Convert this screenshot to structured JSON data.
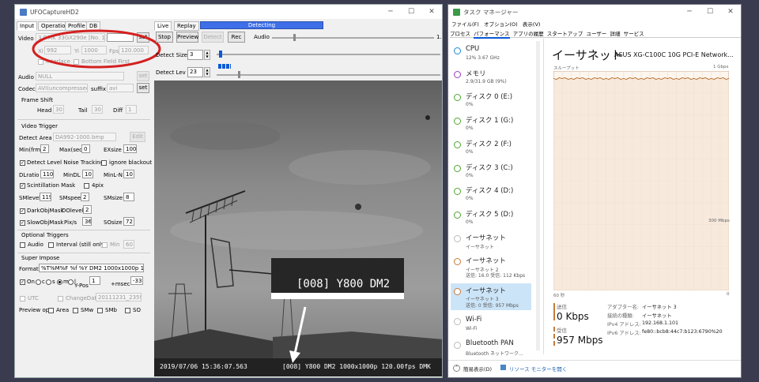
{
  "ufo": {
    "title": "UFOCaptureHD2",
    "tabs": [
      "Input",
      "Operation",
      "Profile",
      "DB"
    ],
    "video_label": "Video",
    "device": "3 DMK 33GX290e [No. 1]",
    "set_label": "set",
    "xi_label": "Xi",
    "xi_value": "992",
    "yi_label": "Yi",
    "yi_value": "1000",
    "fps_label": "Fps",
    "fps_value": "120.000",
    "interlace_label": "Interlace",
    "bottom_field_label": "Bottom Field First",
    "audio_label": "Audio",
    "audio_value": "NULL",
    "codec_label": "Codec",
    "codec_value": "AVI(uncompressed)",
    "suffix_label": "suffix",
    "suffix_value": "avi",
    "frame_shift_title": "Frame Shift",
    "head_label": "Head",
    "head_value": "30",
    "tail_label": "Tail",
    "tail_value": "30",
    "diff_label": "Diff",
    "diff_value": "1",
    "video_trigger_title": "Video Trigger",
    "detect_area_label": "Detect Area",
    "detect_area_value": "DA992-1000.bmp",
    "edit_label": "Edit",
    "minfrm_label": "Min(frm)",
    "minfrm_value": "2",
    "maxsec_label": "Max(sec)",
    "maxsec_value": "0",
    "exsize_label": "EXsize",
    "exsize_value": "100",
    "dlnt_label": "Detect Level Noise Tracking",
    "ignore_blackout_label": "ignore blackout",
    "dlratio_label": "DLratio",
    "dlratio_value": "110",
    "mindl_label": "MinDL",
    "mindl_value": "10",
    "minln_label": "MinL-N",
    "minln_value": "10",
    "scint_label": "Scintillation Mask",
    "pix4_label": "4pix",
    "smlevel_label": "SMlevel",
    "smlevel_value": "119",
    "smspeed_label": "SMspeed",
    "smspeed_value": "2",
    "smsize_label": "SMsize",
    "smsize_value": "8",
    "darkobj_label": "DarkObjMask",
    "dolevel_label": "DOlevel",
    "dolevel_value": "2",
    "slowobj_label": "SlowObjMask",
    "pixs_label": "Pix/s",
    "pixs_value": "36",
    "sosize_label": "SOsize",
    "sosize_value": "72",
    "opt_triggers_title": "Optional Triggers",
    "opt_audio_label": "Audio",
    "interval_label": "Interval (still only",
    "min_label": "Min",
    "min_value": "60",
    "super_impose_title": "Super Impose",
    "format_label": "Format",
    "format_value": "%T%M%F %f %Y DM2 1000x1000p 120.00f",
    "on_label": "On",
    "c_label": "c",
    "s_label": "s",
    "m_label": "m",
    "l_label": "l",
    "ypos_label": "Y-Pos",
    "ypos_value": "1",
    "msec_label": "+msec",
    "msec_value": "-33",
    "utc_label": "UTC",
    "change_date_label": "ChangeDate",
    "change_date_value": "20111231_235959",
    "preview_opt_label": "Preview opt",
    "area_label": "Area",
    "smw_label": "SMw",
    "smb_label": "SMb",
    "so_label": "SO",
    "live_tab": "Live",
    "replay_tab": "Replay",
    "status": "Detecting",
    "stop_label": "Stop",
    "preview_label": "Preview",
    "detect_label": "Detect",
    "rec_label": "Rec",
    "audio_slider_label": "Audio",
    "audio_slider_value": "1.",
    "detect_size_label": "Detect Size",
    "detect_size_value": "3",
    "detect_lev_label": "Detect Lev",
    "detect_lev_value": "23",
    "zoom_label": "[008] Y800 DM2",
    "timestamp": "2019/07/06 15:36:07.563",
    "overlay": "[008] Y800 DM2 1000x1000p 120.00fps DMK"
  },
  "tm": {
    "title": "タスク マネージャー",
    "menu": [
      "ファイル(F)",
      "オプション(O)",
      "表示(V)"
    ],
    "tabs": [
      "プロセス",
      "パフォーマンス",
      "アプリの履歴",
      "スタートアップ",
      "ユーザー",
      "詳細",
      "サービス"
    ],
    "items": [
      {
        "name": "CPU",
        "sub": "12% 3.67 GHz",
        "color": "#1a8ad4"
      },
      {
        "name": "メモリ",
        "sub": "2.9/31.9 GB (9%)",
        "color": "#9b3cc6"
      },
      {
        "name": "ディスク 0 (E:)",
        "sub": "0%",
        "color": "#4ea72e"
      },
      {
        "name": "ディスク 1 (G:)",
        "sub": "0%",
        "color": "#4ea72e"
      },
      {
        "name": "ディスク 2 (F:)",
        "sub": "0%",
        "color": "#4ea72e"
      },
      {
        "name": "ディスク 3 (C:)",
        "sub": "0%",
        "color": "#4ea72e"
      },
      {
        "name": "ディスク 4 (D:)",
        "sub": "0%",
        "color": "#4ea72e"
      },
      {
        "name": "ディスク 5 (D:)",
        "sub": "0%",
        "color": "#4ea72e"
      },
      {
        "name": "イーサネット",
        "sub": "イーサネット",
        "color": "#bbbbbb"
      },
      {
        "name": "イーサネット",
        "sub": "イーサネット 2",
        "sub2": "送信: 16.0  受信: 112 Kbps",
        "color": "#c77a3a"
      },
      {
        "name": "イーサネット",
        "sub": "イーサネット 3",
        "sub2": "送信: 0  受信: 957 Mbps",
        "color": "#c77a3a"
      },
      {
        "name": "Wi-Fi",
        "sub": "Wi-Fi",
        "color": "#bbbbbb"
      },
      {
        "name": "Bluetooth PAN",
        "sub": "Bluetooth ネットワーク...",
        "color": "#bbbbbb"
      }
    ],
    "detail_title": "イーサネット",
    "adapter": "ASUS XG-C100C 10G PCI-E Network...",
    "throughput_label": "スループット",
    "max_label": "1 Gbps",
    "mid_label": "300 Mbps",
    "x_left": "60 秒",
    "x_right": "0",
    "send_label": "送信",
    "send_value": "0 Kbps",
    "recv_label": "受信",
    "recv_value": "957 Mbps",
    "info": [
      {
        "k": "アダプター名:",
        "v": "イーサネット 3"
      },
      {
        "k": "接続の種類:",
        "v": "イーサネット"
      },
      {
        "k": "IPv4 アドレス:",
        "v": "192.168.1.101"
      },
      {
        "k": "IPv6 アドレス:",
        "v": "fe80::bcb8:44c7:b123:6790%20"
      }
    ],
    "footer_left": "簡易表示(D)",
    "footer_right": "リソース モニターを開く"
  },
  "colors": {
    "accent": "#0a58d6",
    "ethernet": "#c77a3a",
    "graph_bg": "#fdf6ef",
    "graph_line": "#a74f01"
  }
}
